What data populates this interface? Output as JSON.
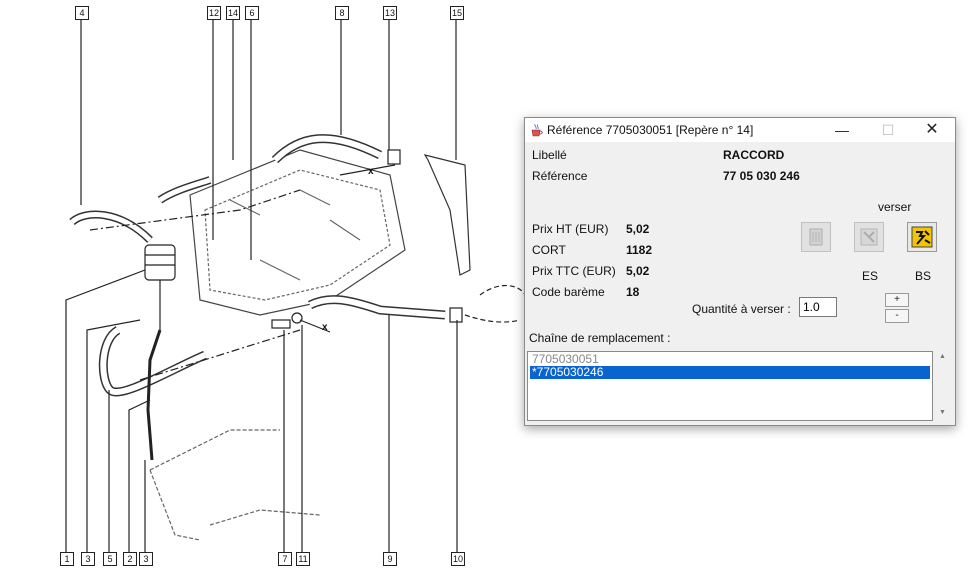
{
  "diagram": {
    "callouts_top": [
      "4",
      "12",
      "14",
      "6",
      "8",
      "13",
      "15"
    ],
    "callouts_bottom": [
      "1",
      "3",
      "5",
      "2",
      "3",
      "7",
      "11",
      "9",
      "10"
    ],
    "cross_marks": [
      "x",
      "x"
    ]
  },
  "dialog": {
    "title": "Référence 7705030051 [Repère n° 14]",
    "window_controls": {
      "minimize": "—",
      "maximize": "☐",
      "close": "✕"
    },
    "libelle_label": "Libellé",
    "libelle_value": "RACCORD",
    "reference_label": "Référence",
    "reference_value": "77 05 030 246",
    "prix_ht_label": "Prix HT (EUR)",
    "prix_ht_value": "5,02",
    "cort_label": "CORT",
    "cort_value": "1182",
    "prix_ttc_label": "Prix TTC (EUR)",
    "prix_ttc_value": "5,02",
    "code_bareme_label": "Code barème",
    "code_bareme_value": "18",
    "verser_label": "verser",
    "es_label": "ES",
    "bs_label": "BS",
    "quantite_label": "Quantité à verser :",
    "quantite_value": "1.0",
    "plus_label": "+",
    "minus_label": "-",
    "chain_label": "Chaîne de remplacement :",
    "chain_items": [
      "7705030051",
      "*7705030246"
    ],
    "selected_color": "#0a64d0"
  }
}
